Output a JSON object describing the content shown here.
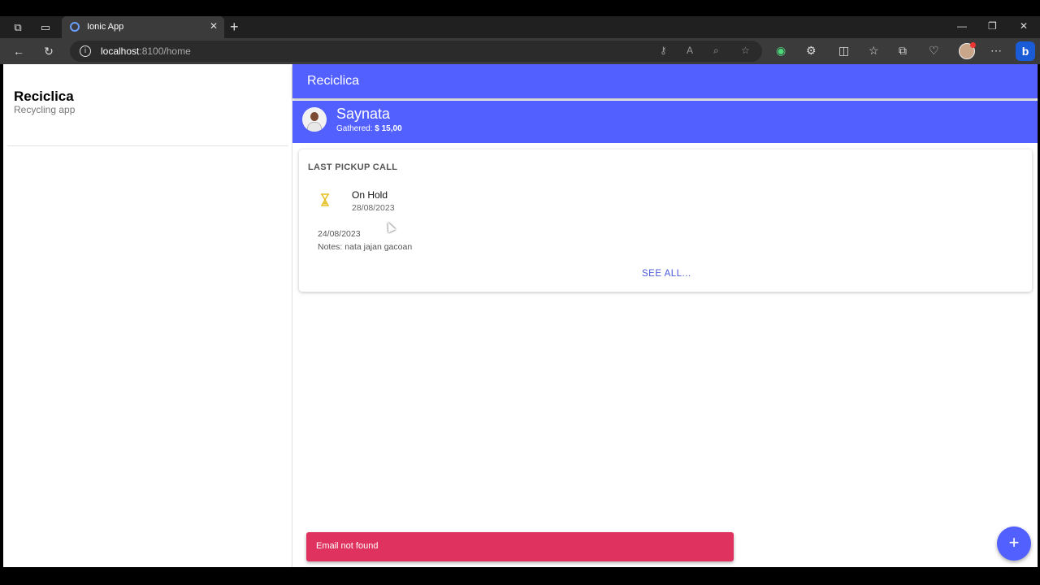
{
  "browser": {
    "tab_title": "Ionic App",
    "tab_close": "✕",
    "new_tab": "+",
    "url_host": "localhost",
    "url_path": ":8100/home",
    "minimize": "—",
    "maximize": "❐",
    "close": "✕",
    "back": "←",
    "reload": "↻",
    "more": "⋯",
    "bing": "b"
  },
  "menu": {
    "title": "Reciclica",
    "subtitle": "Recycling app"
  },
  "header": {
    "title": "Reciclica"
  },
  "user": {
    "name": "Saynata",
    "gathered_label": "Gathered:",
    "gathered_value": "$ 15,00"
  },
  "card": {
    "title": "LAST PICKUP CALL",
    "status": "On Hold",
    "status_date": "28/08/2023",
    "date": "24/08/2023",
    "notes": "Notes: nata jajan gacoan",
    "see_all": "SEE ALL..."
  },
  "toast": {
    "message": "Email not found"
  },
  "fab": {
    "label": "+"
  },
  "colors": {
    "primary": "#5260ff",
    "danger": "#e0325f",
    "warning": "#e6c229"
  }
}
